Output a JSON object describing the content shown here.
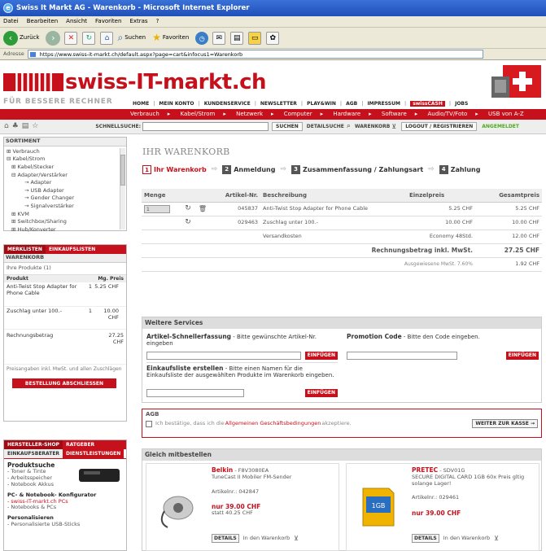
{
  "window": {
    "title": "Swiss It Markt AG - Warenkorb - Microsoft Internet Explorer",
    "menu": [
      "Datei",
      "Bearbeiten",
      "Ansicht",
      "Favoriten",
      "Extras",
      "?"
    ],
    "toolbar": {
      "back": "Zurück",
      "search": "Suchen",
      "favorites": "Favoriten"
    },
    "address_label": "Adresse",
    "address_url": "https://www.swiss-it-markt.ch/default.aspx?page=cart&infocus1=Warenkorb"
  },
  "site": {
    "logo_text": "swiss-IT-markt.ch",
    "slogan": "FÜR BESSERE RECHNER",
    "topnav": [
      "HOME",
      "MEIN KONTO",
      "KUNDENSERVICE",
      "NEWSLETTER",
      "PLAY&WIN",
      "AGB",
      "IMPRESSUM",
      "swissCASH",
      "JOBS"
    ],
    "category_nav": [
      "Verbrauch",
      "Kabel/Strom",
      "Netzwerk",
      "Computer",
      "Hardware",
      "Software",
      "Audio/TV/Foto",
      "USB von A-Z"
    ],
    "schnellsuche_label": "SCHNELLSUCHE:",
    "search_button": "SUCHEN",
    "detailsuche": "DETAILSUCHE",
    "warenkorb_link": "WARENKORB",
    "logout": "LOGOUT / REGISTRIEREN",
    "angemeldet": "ANGEMELDET",
    "colors": {
      "brand_red": "#c6101b",
      "green": "#4caa1c"
    }
  },
  "sidebar": {
    "sortiment_title": "SORTIMENT",
    "tree": [
      "⊞ Verbrauch",
      "⊟ Kabel/Strom",
      "⊞ Kabel/Stecker",
      "⊟ Adapter/Verstärker",
      "→ Adapter",
      "→ USB Adapter",
      "→ Gender Changer",
      "→ Signalverstärker",
      "⊞ KVM",
      "⊞ Switchbox/Sharing",
      "⊞ Hub/Konverter"
    ],
    "tabs": [
      "MERKLISTEN",
      "EINKAUFSLISTEN"
    ],
    "warenkorb_title": "WARENKORB",
    "products_count": "Ihre Produkte (1)",
    "col_product": "Produkt",
    "col_price": "Mg. Preis",
    "items": [
      {
        "name": "Anti-Twist Stop Adapter for Phone Cable",
        "qty": "1",
        "price": "5.25 CHF"
      },
      {
        "name": "Zuschlag unter 100.-",
        "qty": "1",
        "price": "10.00 CHF"
      }
    ],
    "rechnungsbetrag_label": "Rechnungsbetrag",
    "rechnungsbetrag_value": "27.25 CHF",
    "preis_note": "Preisangaben inkl. MwSt. und allen Zuschlägen",
    "checkout_button": "BESTELLUNG ABSCHLIESSEN",
    "bottom_tabs_1": [
      "HERSTELLER-SHOP",
      "RATGEBER"
    ],
    "bottom_tabs_2": [
      "EINKAUFSBERATER",
      "DIENSTLEISTUNGEN"
    ],
    "produktsuche": "Produktsuche",
    "produktsuche_items": [
      "- Toner & Tinte",
      "- Arbeitsspeicher",
      "- Notebook Akkus"
    ],
    "konfigurator": "PC- & Notebook- Konfigurator",
    "konfigurator_items": [
      "- swiss-IT-markt.ch PCs",
      "- Notebooks & PCs"
    ],
    "personalisieren": "Personalisieren",
    "personalisieren_items": [
      "- Personalisierte USB-Sticks"
    ]
  },
  "main": {
    "title": "IHR WARENKORB",
    "steps": [
      {
        "num": "1",
        "label": "Ihr Warenkorb"
      },
      {
        "num": "2",
        "label": "Anmeldung"
      },
      {
        "num": "3",
        "label": "Zusammenfassung / Zahlungsart"
      },
      {
        "num": "4",
        "label": "Zahlung"
      }
    ],
    "columns": [
      "Menge",
      "Artikel-Nr.",
      "Beschreibung",
      "Einzelpreis",
      "Gesamtpreis"
    ],
    "rows": [
      {
        "qty": "1",
        "artnr": "045837",
        "desc": "Anti-Twist Stop Adapter for Phone Cable",
        "einzel": "5.25 CHF",
        "gesamt": "5.25 CHF"
      },
      {
        "qty": "",
        "artnr": "029463",
        "desc": "Zuschlag unter 100.-",
        "einzel": "10.00 CHF",
        "gesamt": "10.00 CHF"
      }
    ],
    "versand_label": "Versandkosten",
    "versand_method": "Economy 48Std.",
    "versand_price": "12.00 CHF",
    "total_label": "Rechnungsbetrag inkl. MwSt.",
    "total_value": "27.25 CHF",
    "mwst_label": "Ausgewiesene MwSt. 7.60%",
    "mwst_value": "1.92 CHF",
    "services": {
      "title": "Weitere Services",
      "schnell_title": "Artikel-Schnellerfassung",
      "schnell_desc": " - Bitte gewünschte Artikel-Nr. eingeben",
      "promo_title": "Promotion Code",
      "promo_desc": " - Bitte den Code eingeben.",
      "liste_title": "Einkaufsliste erstellen",
      "liste_desc": " - Bitte einen Namen für die Einkaufsliste der ausgewählten Produkte im Warenkorb eingeben.",
      "einfuegen": "EINFÜGEN"
    },
    "agb": {
      "title": "AGB",
      "text_before": "Ich bestätige, dass ich die ",
      "link": "Allgemeinen Geschäftsbedingungen",
      "text_after": " akzeptiere.",
      "button": "WEITER ZUR KASSE →"
    },
    "gleich": {
      "title": "Gleich mitbestellen",
      "products": [
        {
          "brand": "Belkin",
          "code": " - F8V3080EA",
          "desc": "TuneCast II Mobiler FM-Sender",
          "artnr": "Artikelnr.: 042847",
          "price": "nur 39.00 CHF",
          "old": "statt 40.25 CHF",
          "details": "DETAILS",
          "cart": "In den Warenkorb"
        },
        {
          "brand": "PRETEC",
          "code": " - SDV01G",
          "desc": "SECURE DIGITAL CARD 1GB 60x Preis gltig solange Lager!",
          "artnr": "Artikelnr.: 029461",
          "price": "nur 39.00 CHF",
          "old": "",
          "details": "DETAILS",
          "cart": "In den Warenkorb"
        }
      ]
    }
  }
}
